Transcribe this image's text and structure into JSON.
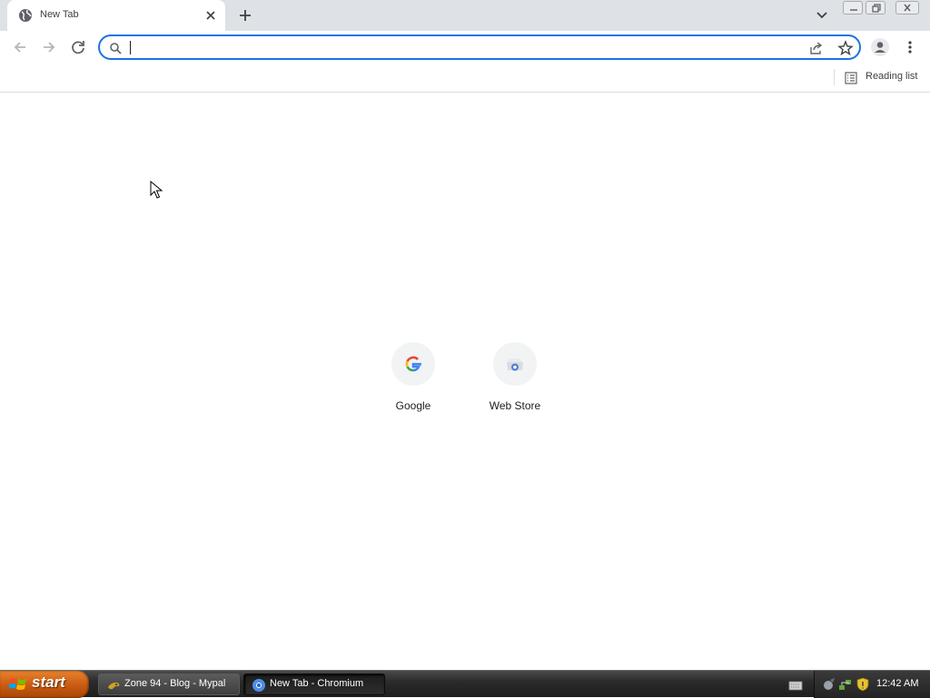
{
  "tab": {
    "title": "New Tab"
  },
  "omnibox": {
    "value": "",
    "placeholder": ""
  },
  "bookmarks": {
    "reading_list": "Reading list"
  },
  "shortcuts": [
    {
      "label": "Google",
      "icon": "google-g-icon"
    },
    {
      "label": "Web Store",
      "icon": "web-store-icon"
    }
  ],
  "taskbar": {
    "start_label": "start",
    "tasks": [
      {
        "label": "Zone 94 - Blog - Mypal",
        "active": false
      },
      {
        "label": "New Tab - Chromium",
        "active": true
      }
    ],
    "clock": "12:42 AM"
  },
  "colors": {
    "accent": "#1a73e8",
    "tabstrip": "#dee1e6",
    "start_orange": "#c85a12",
    "taskbar": "#2b2b2b"
  }
}
